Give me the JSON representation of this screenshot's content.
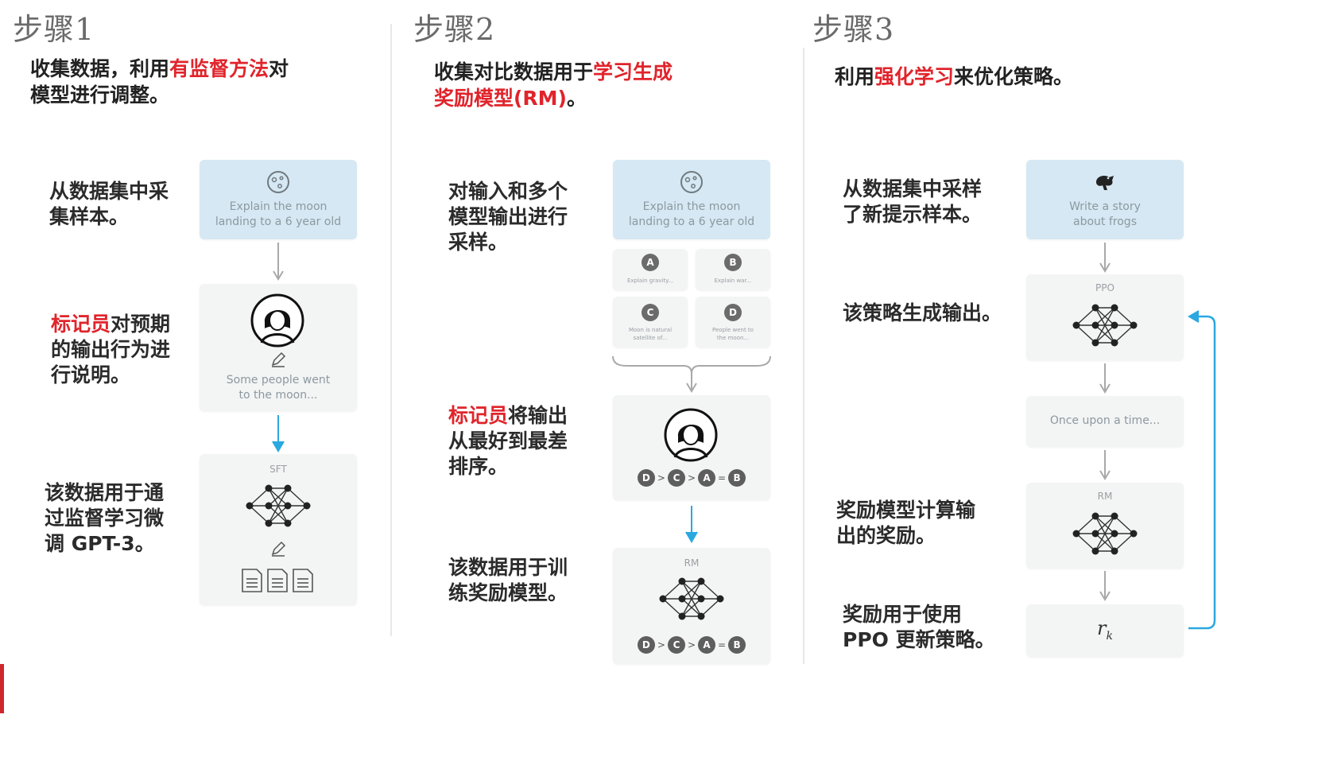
{
  "step1": {
    "title": "步骤1",
    "heading_pre": "收集数据，利用",
    "heading_hl": "有监督方法",
    "heading_post": "对",
    "heading_line2": "模型进行调整。",
    "label1": "从数据集中采\n集样本。",
    "label2_hl": "标记员",
    "label2_line1_rest": "对预期",
    "label2_rest": "的输出行为进\n行说明。",
    "label3": "该数据用于通\n过监督学习微\n调 GPT-3。",
    "prompt": "Explain the moon\nlanding to a 6 year old",
    "demo_text": "Some people went\nto the moon...",
    "model_label": "SFT"
  },
  "step2": {
    "title": "步骤2",
    "heading_pre": "收集对比数据用于",
    "heading_hl1": "学习生成",
    "heading_hl2": "奖励模型(RM)",
    "heading_post": "。",
    "label1": "对输入和多个\n模型输出进行\n采样。",
    "label2_hl": "标记员",
    "label2_line1_rest": "将输出",
    "label2_rest": "从最好到最差\n排序。",
    "label3": "该数据用于训\n练奖励模型。",
    "prompt": "Explain the moon\nlanding to a 6 year old",
    "outputs": [
      {
        "letter": "A",
        "text": "Explain gravity..."
      },
      {
        "letter": "B",
        "text": "Explain war..."
      },
      {
        "letter": "C",
        "text": "Moon is natural\nsatellite of..."
      },
      {
        "letter": "D",
        "text": "People went to\nthe moon..."
      }
    ],
    "ranking": [
      "D",
      ">",
      "C",
      ">",
      "A",
      "=",
      "B"
    ],
    "model_label": "RM"
  },
  "step3": {
    "title": "步骤3",
    "heading_pre": "利用",
    "heading_hl": "强化学习",
    "heading_post": "来优化策略。",
    "label1": "从数据集中采样\n了新提示样本。",
    "label2": "该策略生成输出。",
    "label3": "奖励模型计算输\n出的奖励。",
    "label4": "奖励用于使用\nPPO 更新策略。",
    "prompt": "Write a story\nabout frogs",
    "policy_label": "PPO",
    "output_text": "Once upon a time...",
    "rm_label": "RM",
    "reward_symbol": "r",
    "reward_sub": "k"
  },
  "colors": {
    "accent_red": "#e0242b",
    "prompt_blue": "#d6e8f3",
    "arrow_blue": "#2aa8e0",
    "card_gray": "#f3f4f4"
  }
}
